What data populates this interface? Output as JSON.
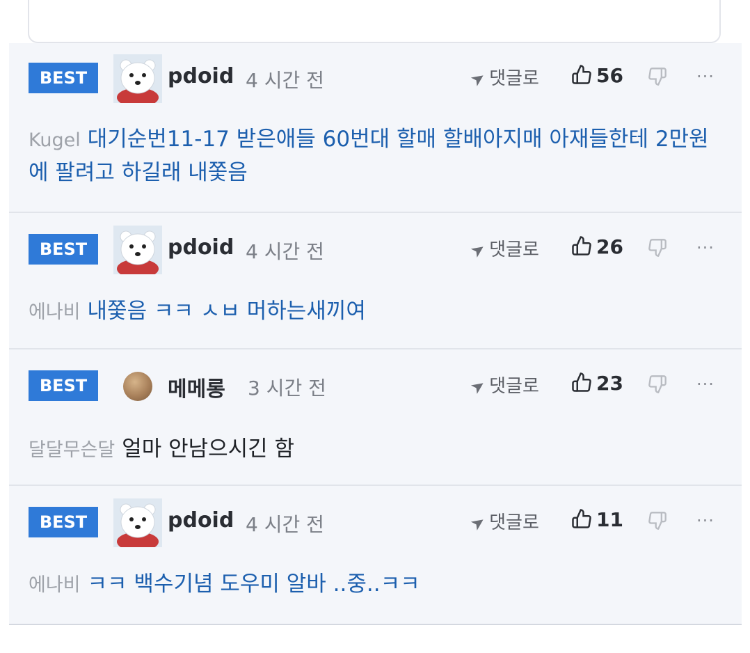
{
  "comments": [
    {
      "badge": "BEST",
      "username": "pdoid",
      "time": "4 시간 전",
      "reply_label": "댓글로",
      "likes": "56",
      "more": "···",
      "mention": "Kugel",
      "text": "대기순번11-17 받은애들 60번대 할매 할배아지매 아재들한테 2만원에 팔려고 하길래 내쫓음",
      "avatar": "polar-bear-icon"
    },
    {
      "badge": "BEST",
      "username": "pdoid",
      "time": "4 시간 전",
      "reply_label": "댓글로",
      "likes": "26",
      "more": "···",
      "mention": "에나비",
      "text": "내쫓음 ㅋㅋ ㅅㅂ 머하는새끼여",
      "avatar": "polar-bear-icon"
    },
    {
      "badge": "BEST",
      "username": "메메롱",
      "time": "3 시간 전",
      "reply_label": "댓글로",
      "likes": "23",
      "more": "···",
      "mention": "달달무슨달",
      "text": "얼마 안남으시긴 함",
      "avatar": "round-avatar"
    },
    {
      "badge": "BEST",
      "username": "pdoid",
      "time": "4 시간 전",
      "reply_label": "댓글로",
      "likes": "11",
      "more": "···",
      "mention": "에나비",
      "text": "ㅋㅋ 백수기념 도우미 알바 ..중..ㅋㅋ",
      "avatar": "polar-bear-icon"
    }
  ],
  "colors": {
    "badge": "#2f7ad8",
    "link_text": "#1c5fae",
    "list_bg": "#f4f6fa"
  }
}
